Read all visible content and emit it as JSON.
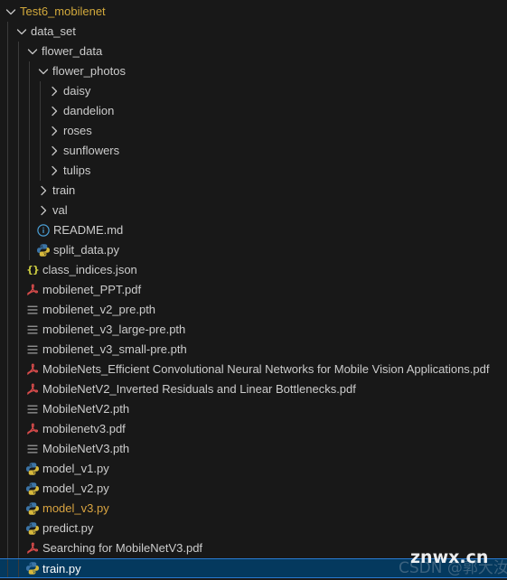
{
  "explorer": {
    "background": "#181818",
    "selection_color": "#04395e",
    "selection_border": "#2a7ad0",
    "root_label_color": "#d2a93c",
    "modified_color": "#d9a441",
    "file_text_color": "#cccccc",
    "rows": [
      {
        "label": "Test6_mobilenet",
        "depth": 0,
        "kind": "folder",
        "state": "expanded",
        "icon": "chevron-down-icon",
        "style": "root"
      },
      {
        "label": "data_set",
        "depth": 1,
        "kind": "folder",
        "state": "expanded",
        "icon": "chevron-down-icon",
        "style": "folder"
      },
      {
        "label": "flower_data",
        "depth": 2,
        "kind": "folder",
        "state": "expanded",
        "icon": "chevron-down-icon",
        "style": "folder"
      },
      {
        "label": "flower_photos",
        "depth": 3,
        "kind": "folder",
        "state": "expanded",
        "icon": "chevron-down-icon",
        "style": "folder"
      },
      {
        "label": "daisy",
        "depth": 4,
        "kind": "folder",
        "state": "collapsed",
        "icon": "chevron-right-icon",
        "style": "folder"
      },
      {
        "label": "dandelion",
        "depth": 4,
        "kind": "folder",
        "state": "collapsed",
        "icon": "chevron-right-icon",
        "style": "folder"
      },
      {
        "label": "roses",
        "depth": 4,
        "kind": "folder",
        "state": "collapsed",
        "icon": "chevron-right-icon",
        "style": "folder"
      },
      {
        "label": "sunflowers",
        "depth": 4,
        "kind": "folder",
        "state": "collapsed",
        "icon": "chevron-right-icon",
        "style": "folder"
      },
      {
        "label": "tulips",
        "depth": 4,
        "kind": "folder",
        "state": "collapsed",
        "icon": "chevron-right-icon",
        "style": "folder"
      },
      {
        "label": "train",
        "depth": 3,
        "kind": "folder",
        "state": "collapsed",
        "icon": "chevron-right-icon",
        "style": "folder"
      },
      {
        "label": "val",
        "depth": 3,
        "kind": "folder",
        "state": "collapsed",
        "icon": "chevron-right-icon",
        "style": "folder"
      },
      {
        "label": "README.md",
        "depth": 3,
        "kind": "file",
        "icon": "markdown-info-icon",
        "style": "file"
      },
      {
        "label": "split_data.py",
        "depth": 3,
        "kind": "file",
        "icon": "python-icon",
        "style": "file"
      },
      {
        "label": "class_indices.json",
        "depth": 2,
        "kind": "file",
        "icon": "json-icon",
        "style": "file"
      },
      {
        "label": "mobilenet_PPT.pdf",
        "depth": 2,
        "kind": "file",
        "icon": "pdf-icon",
        "style": "file"
      },
      {
        "label": "mobilenet_v2_pre.pth",
        "depth": 2,
        "kind": "file",
        "icon": "pth-icon",
        "style": "file"
      },
      {
        "label": "mobilenet_v3_large-pre.pth",
        "depth": 2,
        "kind": "file",
        "icon": "pth-icon",
        "style": "file"
      },
      {
        "label": "mobilenet_v3_small-pre.pth",
        "depth": 2,
        "kind": "file",
        "icon": "pth-icon",
        "style": "file"
      },
      {
        "label": "MobileNets_Efficient Convolutional Neural Networks for Mobile Vision Applications.pdf",
        "depth": 2,
        "kind": "file",
        "icon": "pdf-icon",
        "style": "file"
      },
      {
        "label": "MobileNetV2_Inverted Residuals and Linear Bottlenecks.pdf",
        "depth": 2,
        "kind": "file",
        "icon": "pdf-icon",
        "style": "file"
      },
      {
        "label": "MobileNetV2.pth",
        "depth": 2,
        "kind": "file",
        "icon": "pth-icon",
        "style": "file"
      },
      {
        "label": "mobilenetv3.pdf",
        "depth": 2,
        "kind": "file",
        "icon": "pdf-icon",
        "style": "file"
      },
      {
        "label": "MobileNetV3.pth",
        "depth": 2,
        "kind": "file",
        "icon": "pth-icon",
        "style": "file"
      },
      {
        "label": "model_v1.py",
        "depth": 2,
        "kind": "file",
        "icon": "python-icon",
        "style": "file"
      },
      {
        "label": "model_v2.py",
        "depth": 2,
        "kind": "file",
        "icon": "python-icon",
        "style": "file"
      },
      {
        "label": "model_v3.py",
        "depth": 2,
        "kind": "file",
        "icon": "python-icon",
        "style": "modified"
      },
      {
        "label": "predict.py",
        "depth": 2,
        "kind": "file",
        "icon": "python-icon",
        "style": "file"
      },
      {
        "label": "Searching for MobileNetV3.pdf",
        "depth": 2,
        "kind": "file",
        "icon": "pdf-icon",
        "style": "file"
      },
      {
        "label": "train.py",
        "depth": 2,
        "kind": "file",
        "icon": "python-icon",
        "style": "file",
        "selected": true
      }
    ]
  },
  "watermark": {
    "front": "znwx.cn",
    "back": "CSDN @郭大汝"
  }
}
